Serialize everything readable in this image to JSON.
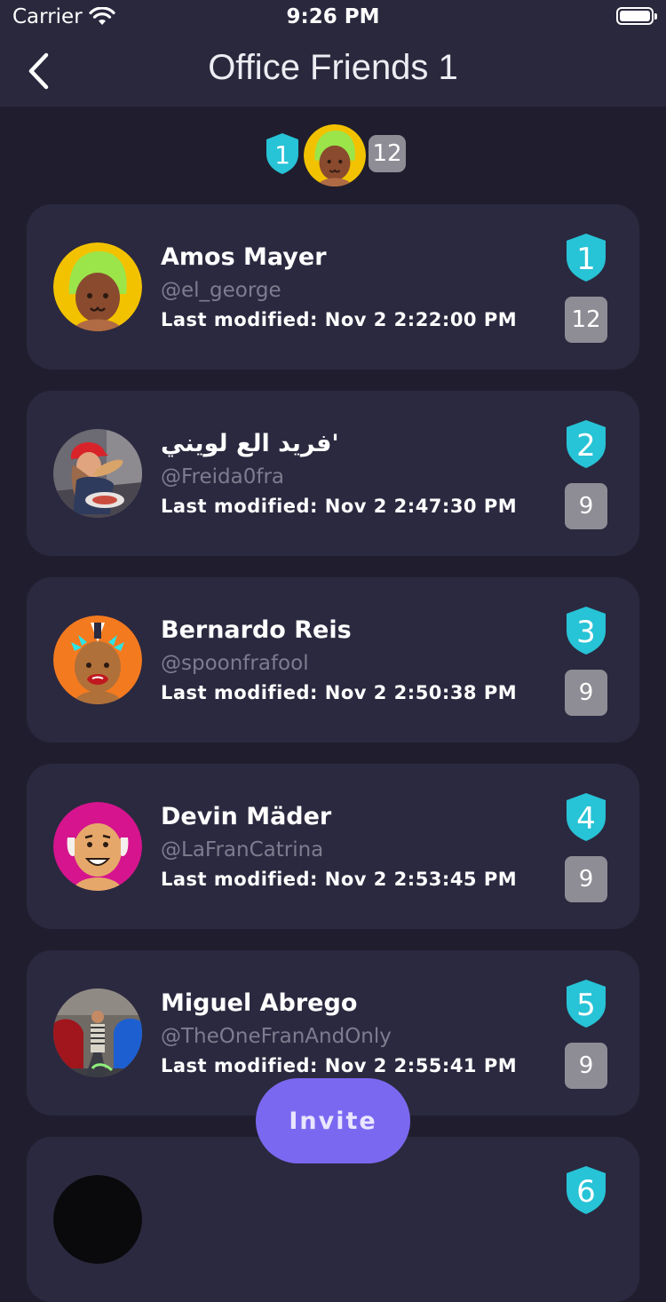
{
  "status_bar": {
    "carrier": "Carrier",
    "time": "9:26 PM"
  },
  "nav": {
    "title": "Office Friends 1",
    "back_icon": "chevron-left-icon"
  },
  "summary": {
    "rank": "1",
    "score": "12",
    "avatar": "cartoon-avatar-green-hair"
  },
  "colors": {
    "background": "#201e2e",
    "card": "#2b293f",
    "rank_badge": "#27c3d6",
    "score_badge": "#8e8d95",
    "invite_button": "#7b68f0",
    "handle_text": "#7e7c8f"
  },
  "players": [
    {
      "rank": "1",
      "name": "Amos Mayer",
      "handle": "@el_george",
      "modified": "Last modified: Nov 2 2:22:00 PM",
      "score": "12",
      "avatar": "cartoon-avatar-green-hair"
    },
    {
      "rank": "2",
      "name": "فريد الع لويني'",
      "handle": "@Freida0fra",
      "modified": "Last modified: Nov 2 2:47:30 PM",
      "score": "9",
      "avatar": "photo-avatar-red-cap"
    },
    {
      "rank": "3",
      "name": "Bernardo Reis",
      "handle": "@spoonfrafool",
      "modified": "Last modified: Nov 2 2:50:38 PM",
      "score": "9",
      "avatar": "cartoon-avatar-orange-mohawk"
    },
    {
      "rank": "4",
      "name": "Devin Mäder",
      "handle": "@LaFranCatrina",
      "modified": "Last modified: Nov 2 2:53:45 PM",
      "score": "9",
      "avatar": "cartoon-avatar-bald-pink"
    },
    {
      "rank": "5",
      "name": "Miguel Abrego",
      "handle": "@TheOneFranAndOnly",
      "modified": "Last modified: Nov 2 2:55:41 PM",
      "score": "9",
      "avatar": "photo-avatar-garage"
    },
    {
      "rank": "6",
      "name": "",
      "handle": "",
      "modified": "",
      "score": "",
      "avatar": "photo-avatar-dark"
    }
  ],
  "invite_label": "Invite"
}
